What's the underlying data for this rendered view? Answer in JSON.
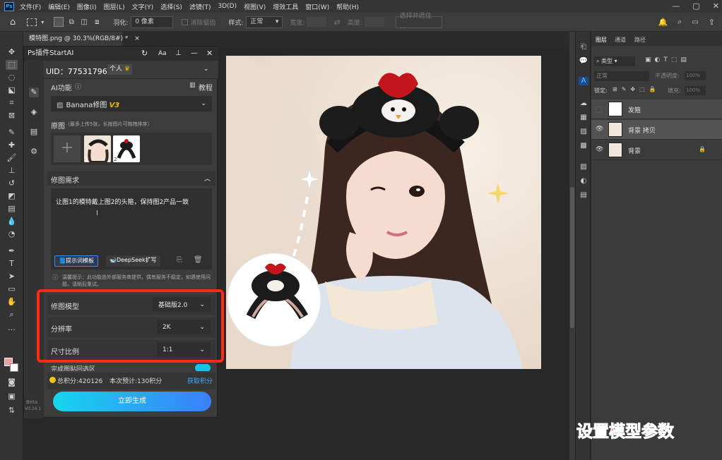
{
  "menubar": {
    "logo": "Ps",
    "items": [
      "文件(F)",
      "编辑(E)",
      "图像(I)",
      "图层(L)",
      "文字(Y)",
      "选择(S)",
      "滤镜(T)",
      "3D(D)",
      "视图(V)",
      "增效工具",
      "窗口(W)",
      "帮助(H)"
    ]
  },
  "options_bar": {
    "feather_label": "羽化:",
    "feather_value": "0 像素",
    "antialias_label": "消除锯齿",
    "style_label": "样式:",
    "style_value": "正常",
    "width_label": "宽度:",
    "height_label": "高度:",
    "select_subject_label": "选择并遮住 ..."
  },
  "document_tab": {
    "title": "模特图.png @ 30.3%(RGB/8#) *",
    "close": "×"
  },
  "plugin": {
    "title": "Ps插件StartAI",
    "uid_label": "UID：775317965",
    "account_type": "个人",
    "ai_feature_label": "AI功能",
    "tutorial_label": "教程",
    "model_select": "Banana修图",
    "model_version": "V3",
    "source_label": "原图",
    "source_hint": "（最多上传5张，长按图片可拖拽排序）",
    "add_symbol": "+",
    "thumb_indices": [
      "1",
      "2"
    ],
    "edit_req_label": "修图需求",
    "prompt_text": "让图1的模特戴上图2的头箍，保持图2产品一致",
    "template_btn": "提示词模板",
    "deepseek_btn": "DeepSeek扩写",
    "notice": "温馨提示：此功能由外部服务商提供，偶有服务不稳定，如遇使用问题，请稍后重试。",
    "model_label": "修图模型",
    "model_value": "基础版2.0",
    "resolution_label": "分辨率",
    "resolution_value": "2K",
    "ratio_label": "尺寸比例",
    "ratio_value": "1:1",
    "partial_label": "完成图贴回选区",
    "total_points": "总积分:420126",
    "estimate": "本次预计:130积分",
    "get_points": "获取积分",
    "generate_btn": "立即生成",
    "beta_label": "Beta",
    "version": "V0.24.1"
  },
  "layers_panel": {
    "tabs": [
      "图层",
      "通道",
      "路径"
    ],
    "filter": "类型",
    "blend_mode": "正常",
    "opacity_label": "不透明度:",
    "opacity_value": "100%",
    "lock_label": "锁定:",
    "fill_label": "填充:",
    "fill_value": "100%",
    "layers": [
      {
        "name": "发箍",
        "visible": false
      },
      {
        "name": "背景 拷贝",
        "visible": true
      },
      {
        "name": "背景",
        "visible": true,
        "locked": true
      }
    ]
  },
  "caption": "设置模型参数",
  "colors": {
    "accent_blue": "#31a8ff",
    "highlight_red": "#ff2a12",
    "gradient_start": "#15d6ec",
    "gradient_end": "#3a7ffb",
    "version_gold": "#f2b705"
  }
}
